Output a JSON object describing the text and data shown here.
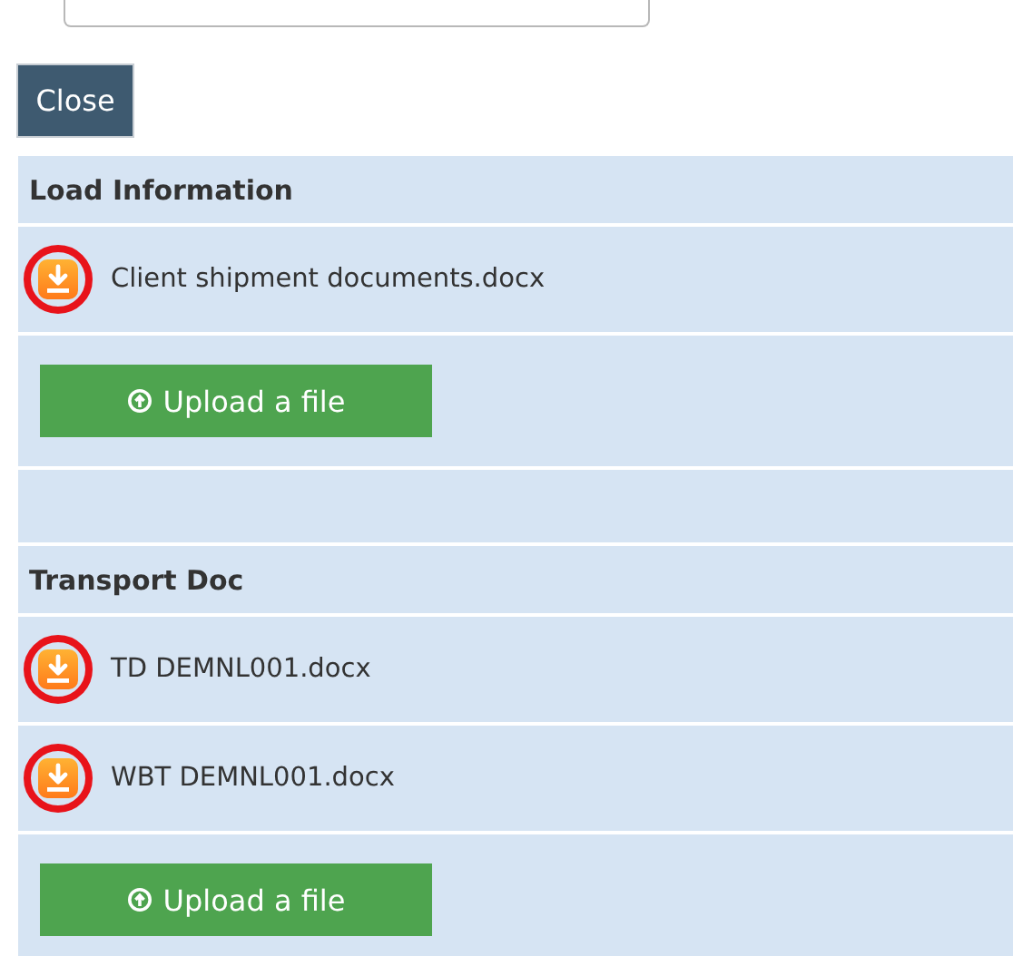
{
  "close_button": {
    "label": "Close"
  },
  "sections": [
    {
      "title": "Load Information",
      "rows": [
        {
          "kind": "file",
          "name": "Client shipment documents.docx",
          "highlighted": true
        },
        {
          "kind": "upload",
          "label": "Upload a file"
        },
        {
          "kind": "blank"
        }
      ]
    },
    {
      "title": "Transport Doc",
      "rows": [
        {
          "kind": "file",
          "name": "TD DEMNL001.docx",
          "highlighted": true
        },
        {
          "kind": "file",
          "name": "WBT DEMNL001.docx",
          "highlighted": true
        },
        {
          "kind": "upload",
          "label": "Upload a file"
        }
      ]
    }
  ]
}
